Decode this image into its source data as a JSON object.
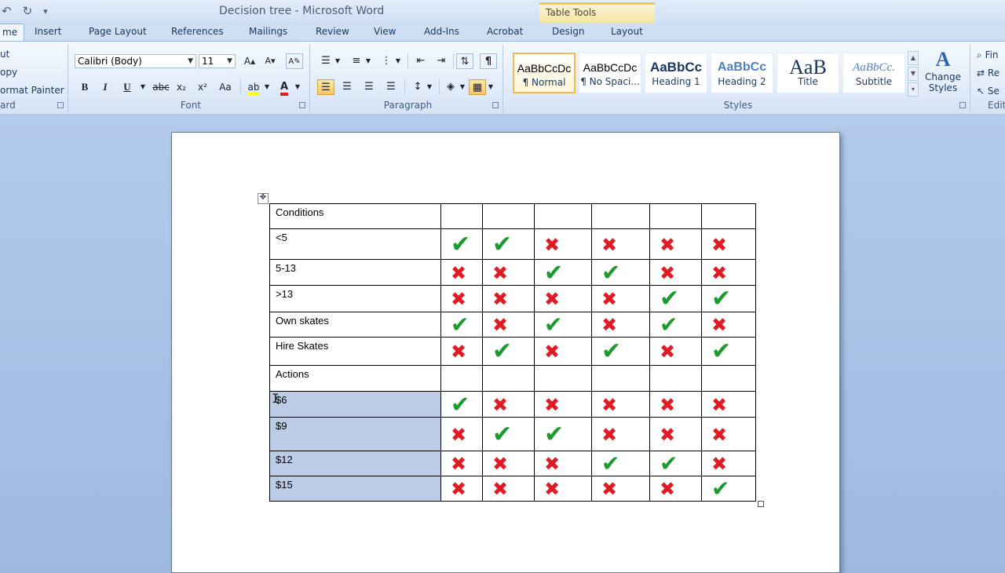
{
  "qat": {
    "undo_icon": "undo-icon",
    "redo_icon": "redo-icon",
    "customize_icon": "customize-qat-icon"
  },
  "window": {
    "title": "Decision tree  -  Microsoft Word",
    "contextual_group": "Table Tools"
  },
  "tabs": [
    {
      "label": "me",
      "active": true
    },
    {
      "label": "Insert"
    },
    {
      "label": "Page Layout"
    },
    {
      "label": "References"
    },
    {
      "label": "Mailings"
    },
    {
      "label": "Review"
    },
    {
      "label": "View"
    },
    {
      "label": "Add-Ins"
    },
    {
      "label": "Acrobat"
    },
    {
      "label": "Design"
    },
    {
      "label": "Layout"
    }
  ],
  "clipboard": {
    "cut": "ut",
    "copy": "opy",
    "format_painter": "ormat Painter",
    "label": "ard"
  },
  "font": {
    "family": "Calibri (Body)",
    "size": "11",
    "label": "Font",
    "bold": "B",
    "italic": "I",
    "underline": "U",
    "strikethrough": "abc",
    "subscript": "x₂",
    "superscript": "x²",
    "change_case": "Aa",
    "font_color": "A",
    "grow": "A▴",
    "shrink": "A▾"
  },
  "paragraph": {
    "label": "Paragraph",
    "show_marks": "¶"
  },
  "styles": {
    "label": "Styles",
    "tiles": [
      {
        "sample": "AaBbCcDc",
        "name": "¶ Normal",
        "selected": true
      },
      {
        "sample": "AaBbCcDc",
        "name": "¶ No Spaci..."
      },
      {
        "sample": "AaBbCc",
        "name": "Heading 1"
      },
      {
        "sample": "AaBbCc",
        "name": "Heading 2"
      },
      {
        "sample": "AaB",
        "name": "Title"
      },
      {
        "sample": "AaBbCc.",
        "name": "Subtitle"
      }
    ],
    "change_styles": "Change Styles"
  },
  "editing": {
    "find": "Fin",
    "replace": "Re",
    "select": "Se",
    "label": "Edit"
  },
  "table": {
    "rows": [
      {
        "label": "Conditions",
        "marks": [
          "",
          "",
          "",
          "",
          "",
          ""
        ],
        "selected": false
      },
      {
        "label": "<5",
        "marks": [
          "tick",
          "tick",
          "cross",
          "cross",
          "cross",
          "cross"
        ],
        "selected": false
      },
      {
        "label": "5-13",
        "marks": [
          "cross",
          "cross",
          "tick",
          "tick",
          "cross",
          "cross"
        ],
        "selected": false
      },
      {
        "label": ">13",
        "marks": [
          "cross",
          "cross",
          "cross",
          "cross",
          "tick",
          "tick"
        ],
        "selected": false
      },
      {
        "label": "Own skates",
        "marks": [
          "tick",
          "cross",
          "tick",
          "cross",
          "tick",
          "cross"
        ],
        "selected": false
      },
      {
        "label": "Hire Skates",
        "marks": [
          "cross",
          "tick",
          "cross",
          "tick",
          "cross",
          "tick"
        ],
        "selected": false
      },
      {
        "label": "Actions",
        "marks": [
          "",
          "",
          "",
          "",
          "",
          ""
        ],
        "selected": false
      },
      {
        "label": "$6",
        "marks": [
          "tick",
          "cross",
          "cross",
          "cross",
          "cross",
          "cross"
        ],
        "selected": true
      },
      {
        "label": "$9",
        "marks": [
          "cross",
          "tick",
          "tick",
          "cross",
          "cross",
          "cross"
        ],
        "selected": true
      },
      {
        "label": "$12",
        "marks": [
          "cross",
          "cross",
          "cross",
          "tick",
          "tick",
          "cross"
        ],
        "selected": true
      },
      {
        "label": "$15",
        "marks": [
          "cross",
          "cross",
          "cross",
          "cross",
          "cross",
          "tick"
        ],
        "selected": true
      }
    ]
  },
  "colors": {
    "tick": "#1c9a2f",
    "cross": "#e01b24",
    "selection": "#bccce4"
  }
}
